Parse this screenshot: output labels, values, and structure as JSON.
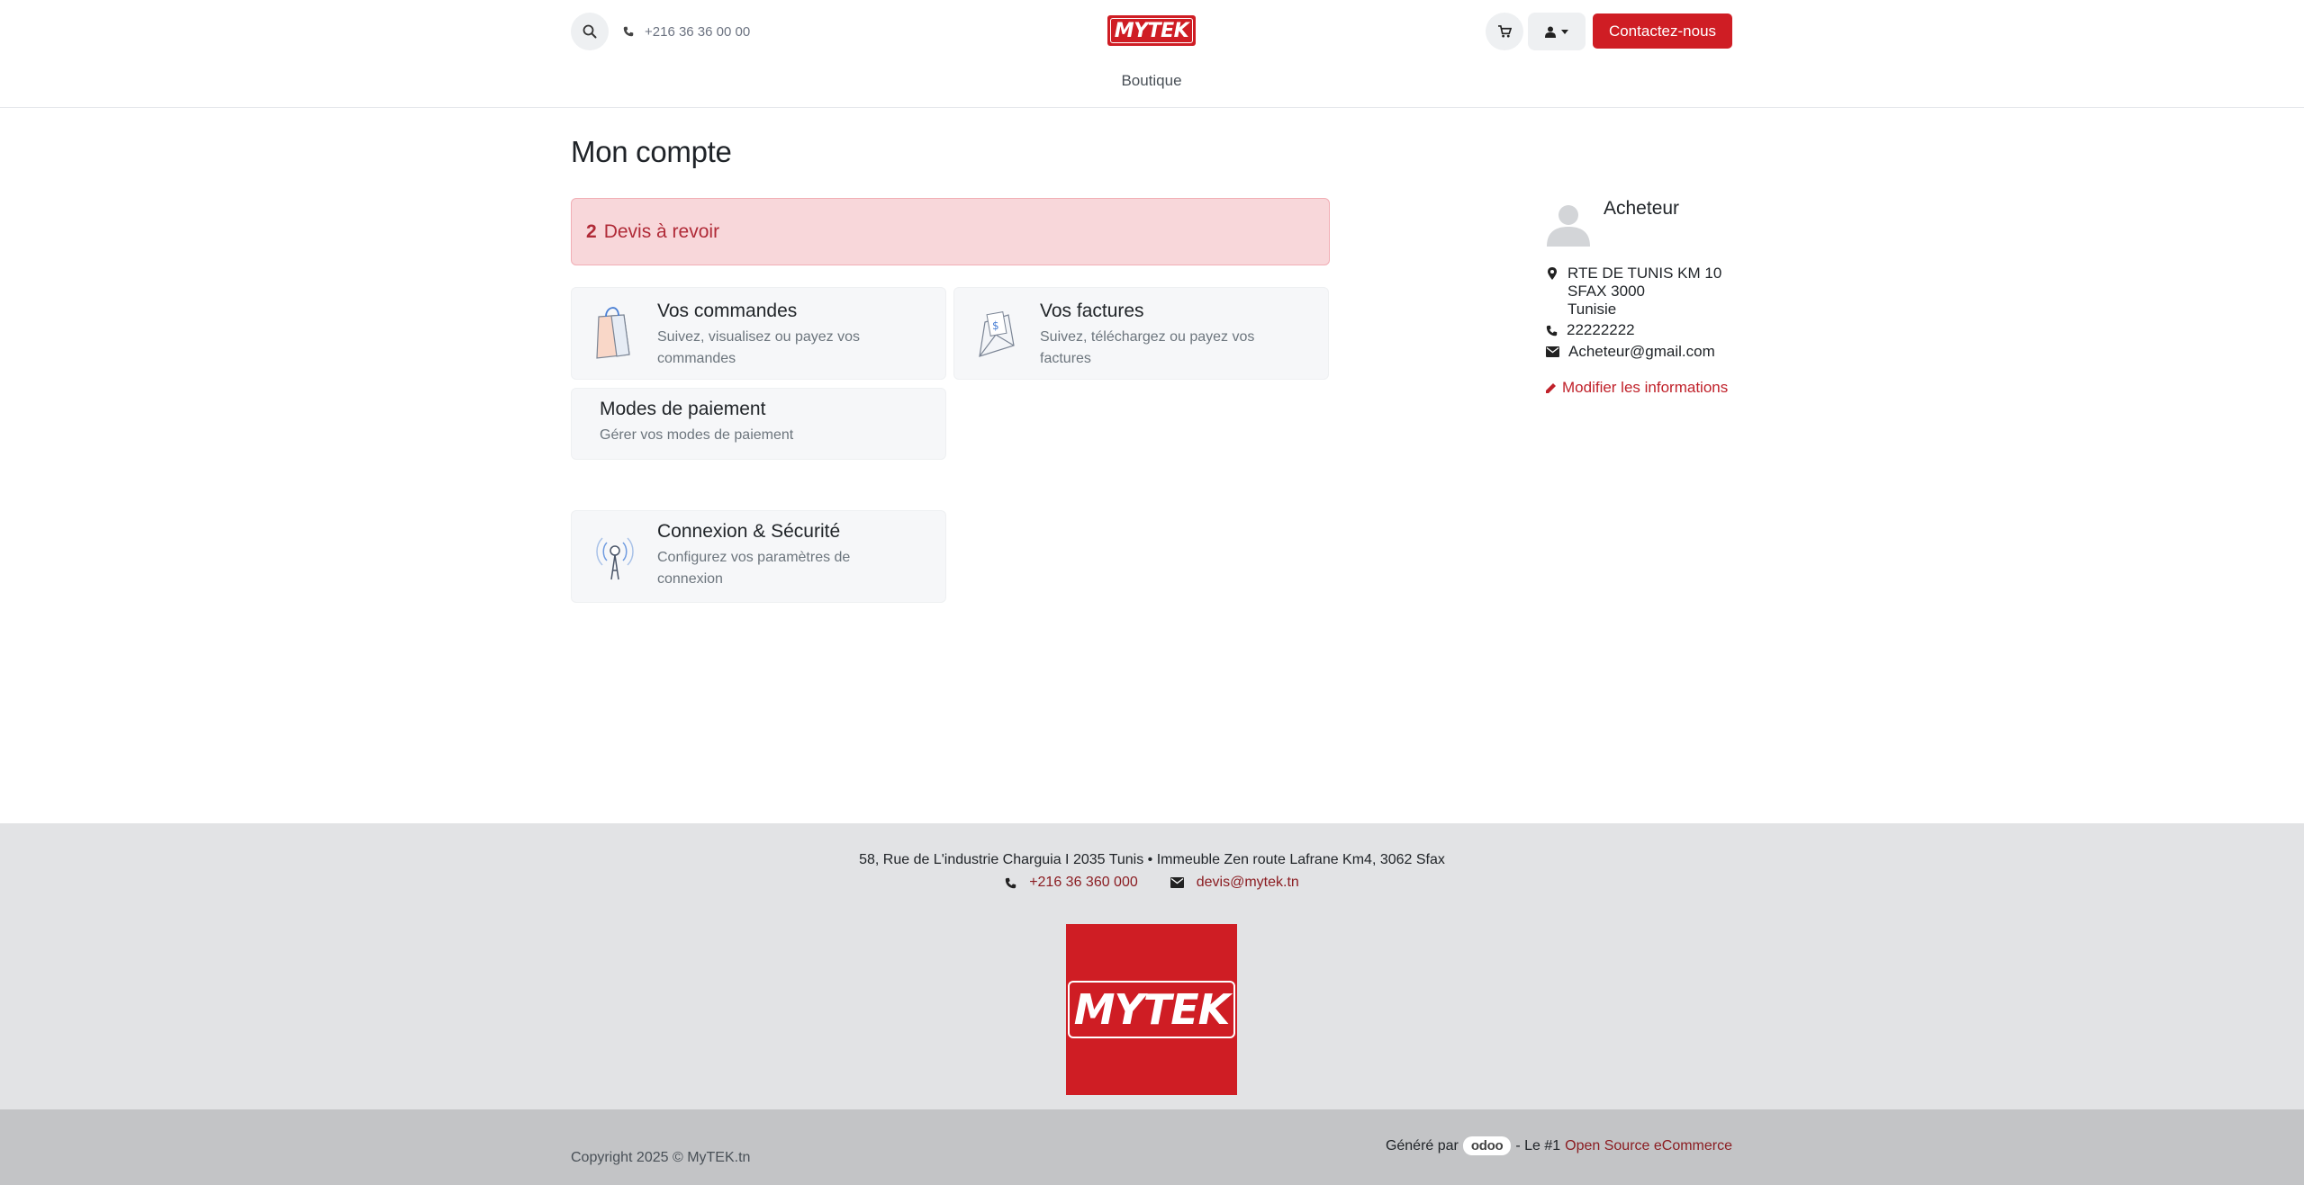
{
  "header": {
    "phone": "+216 36 36 00 00",
    "logo_text": "MYTEK",
    "contact_label": "Contactez-nous",
    "nav": [
      {
        "label": "Boutique"
      }
    ]
  },
  "main": {
    "title": "Mon compte",
    "alert": {
      "count": "2",
      "label": "Devis à revoir"
    },
    "cards": {
      "orders": {
        "title": "Vos commandes",
        "desc": "Suivez, visualisez ou payez vos commandes"
      },
      "invoices": {
        "title": "Vos factures",
        "desc": "Suivez, téléchargez ou payez vos factures"
      },
      "payment": {
        "title": "Modes de paiement",
        "desc": "Gérer vos modes de paiement"
      },
      "security": {
        "title": "Connexion & Sécurité",
        "desc": "Configurez vos paramètres de connexion"
      }
    }
  },
  "sidebar": {
    "name": "Acheteur",
    "address": [
      "RTE DE TUNIS KM 10",
      "SFAX 3000",
      "Tunisie"
    ],
    "phone": "22222222",
    "email": "Acheteur@gmail.com",
    "edit_label": "Modifier les informations"
  },
  "footer": {
    "address": "58, Rue de L'industrie Charguia I 2035 Tunis • Immeuble Zen route Lafrane Km4, 3062 Sfax",
    "phone": "+216 36 360 000",
    "email": "devis@mytek.tn",
    "logo_text": "MYTEK",
    "copyright": "Copyright 2025 © MyTEK.tn",
    "powered_prefix": "Généré par",
    "powered_badge": "odoo",
    "powered_middle": "- Le #1",
    "powered_link": "Open Source eCommerce"
  },
  "colors": {
    "brand_red": "#cf1d24",
    "alert_bg": "#f8d7da",
    "link_red": "#c0212a"
  },
  "icons": [
    "search-icon",
    "phone-icon",
    "cart-icon",
    "user-icon",
    "caret-down-icon",
    "shopping-bag-icon",
    "invoice-envelope-icon",
    "antenna-icon",
    "avatar-icon",
    "map-marker-icon",
    "envelope-icon",
    "pencil-icon"
  ]
}
